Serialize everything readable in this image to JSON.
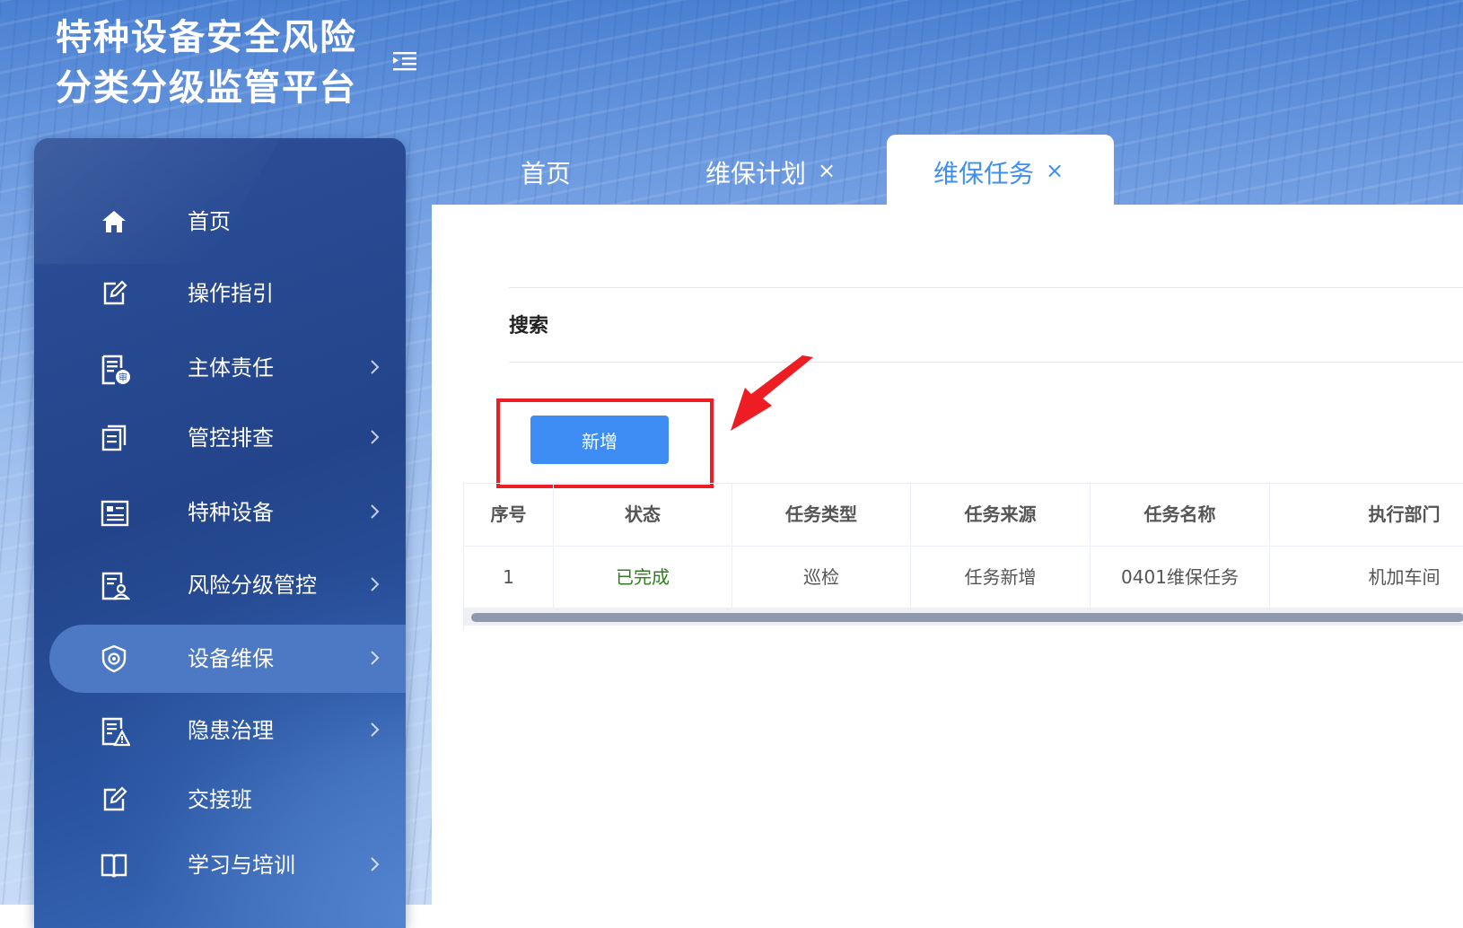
{
  "app": {
    "title_line1": "特种设备安全风险",
    "title_line2": "分类分级监管平台"
  },
  "sidebar": {
    "items": [
      {
        "label": "首页",
        "icon": "home-icon",
        "has_submenu": false
      },
      {
        "label": "操作指引",
        "icon": "edit-icon",
        "has_submenu": false
      },
      {
        "label": "主体责任",
        "icon": "document-review-icon",
        "has_submenu": true
      },
      {
        "label": "管控排查",
        "icon": "copy-document-icon",
        "has_submenu": true
      },
      {
        "label": "特种设备",
        "icon": "profile-card-icon",
        "has_submenu": true
      },
      {
        "label": "风险分级管控",
        "icon": "document-user-icon",
        "has_submenu": true
      },
      {
        "label": "设备维保",
        "icon": "shield-gear-icon",
        "has_submenu": true,
        "active": true
      },
      {
        "label": "隐患治理",
        "icon": "document-warning-icon",
        "has_submenu": true
      },
      {
        "label": "交接班",
        "icon": "edit-icon",
        "has_submenu": false
      },
      {
        "label": "学习与培训",
        "icon": "book-icon",
        "has_submenu": true
      }
    ]
  },
  "tabs": [
    {
      "label": "首页",
      "closable": false,
      "active": false
    },
    {
      "label": "维保计划",
      "closable": true,
      "active": false
    },
    {
      "label": "维保任务",
      "closable": true,
      "active": true
    }
  ],
  "tab_close_glyph": "×",
  "search": {
    "label": "搜索"
  },
  "toolbar": {
    "add_label": "新增"
  },
  "table": {
    "columns": [
      "序号",
      "状态",
      "任务类型",
      "任务来源",
      "任务名称",
      "执行部门"
    ],
    "rows": [
      [
        "1",
        "已完成",
        "巡检",
        "任务新增",
        "0401维保任务",
        "机加车间"
      ]
    ]
  },
  "colors": {
    "accent": "#3d8df4",
    "active_tab_text": "#3f8ef2",
    "status_done": "#2f7d1e",
    "annotation_red": "#ee1d23",
    "sidebar_active": "#4d78c4"
  }
}
